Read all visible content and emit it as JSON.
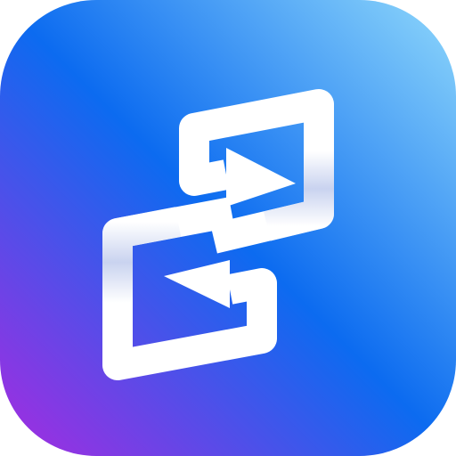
{
  "icon": {
    "name": "transfer-icon",
    "gradient": {
      "top_right": "#8fd8fb",
      "middle": "#0c6bf0",
      "bottom_left": "#a62be0"
    },
    "glyph_color": "#ffffff",
    "glyph_shade": "#b7c4ea"
  }
}
